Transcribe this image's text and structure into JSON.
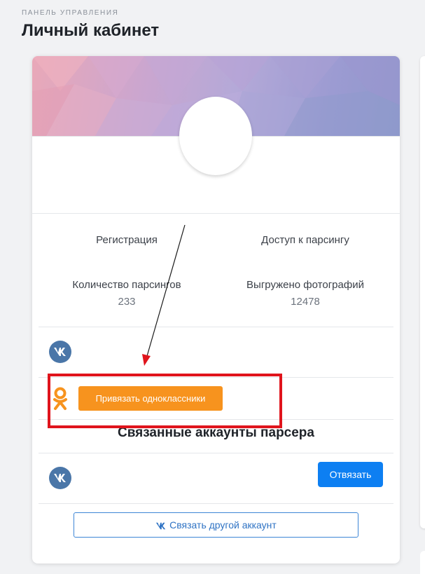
{
  "header": {
    "pretitle": "ПАНЕЛЬ УПРАВЛЕНИЯ",
    "title": "Личный кабинет"
  },
  "stats": [
    {
      "label": "Регистрация",
      "value": ""
    },
    {
      "label": "Доступ к парсингу",
      "value": ""
    },
    {
      "label": "Количество парсингов",
      "value": "233"
    },
    {
      "label": "Выгружено фотографий",
      "value": "12478"
    }
  ],
  "social": {
    "vk_icon": "vk-icon",
    "ok_icon": "odnoklassniki-icon",
    "ok_button": "Привязать одноклассники"
  },
  "linked": {
    "title": "Связанные аккаунты парсера",
    "unlink_button": "Отвязать",
    "link_other_button": "Связать другой аккаунт"
  },
  "colors": {
    "accent_blue": "#0d7ff2",
    "vk_blue": "#4a76a8",
    "ok_orange": "#f7931e",
    "annotation_red": "#e0141c"
  }
}
